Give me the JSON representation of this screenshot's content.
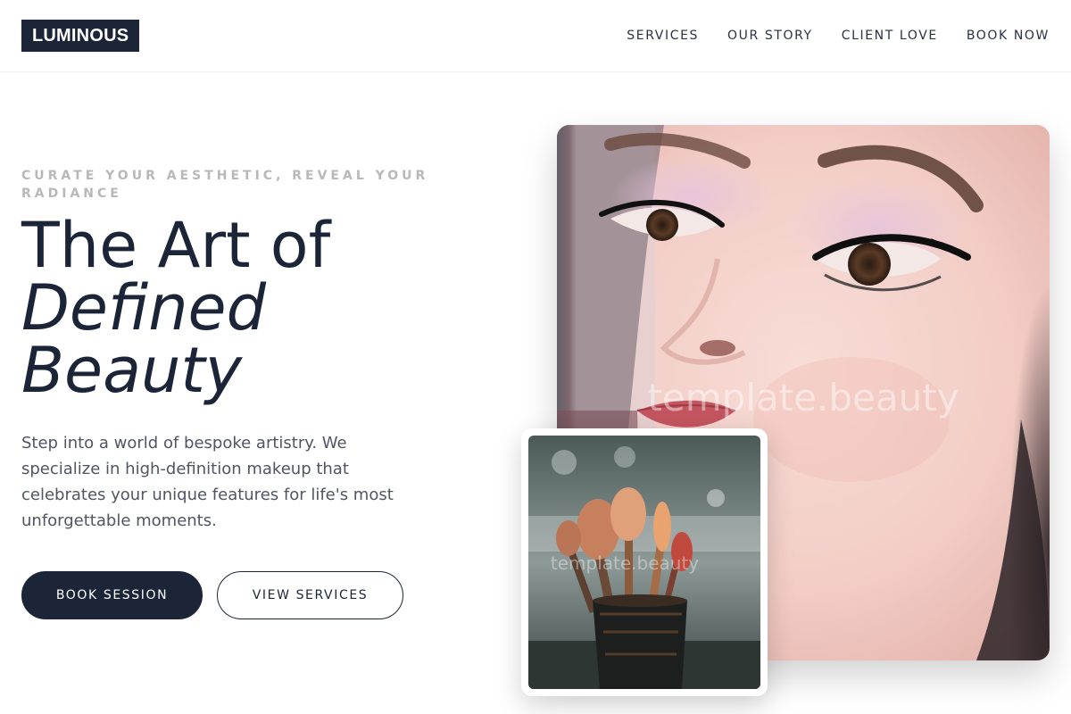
{
  "brand": {
    "logo": "LUMINOUS"
  },
  "nav": {
    "items": [
      "SERVICES",
      "OUR STORY",
      "CLIENT LOVE",
      "BOOK NOW"
    ]
  },
  "hero": {
    "eyebrow": "CURATE YOUR AESTHETIC, REVEAL YOUR RADIANCE",
    "headline_line1": "The Art of",
    "headline_line2": "Defined",
    "headline_line3": "Beauty",
    "description": "Step into a world of bespoke artistry. We specialize in high-definition makeup that celebrates your unique features for life's most unforgettable moments.",
    "primary_button": "BOOK SESSION",
    "secondary_button": "VIEW SERVICES"
  },
  "images": {
    "main_watermark": "template.beauty",
    "secondary_watermark": "template.beauty"
  },
  "colors": {
    "primary": "#1c2438",
    "muted": "#b8b8b8",
    "body_text": "#505563"
  }
}
